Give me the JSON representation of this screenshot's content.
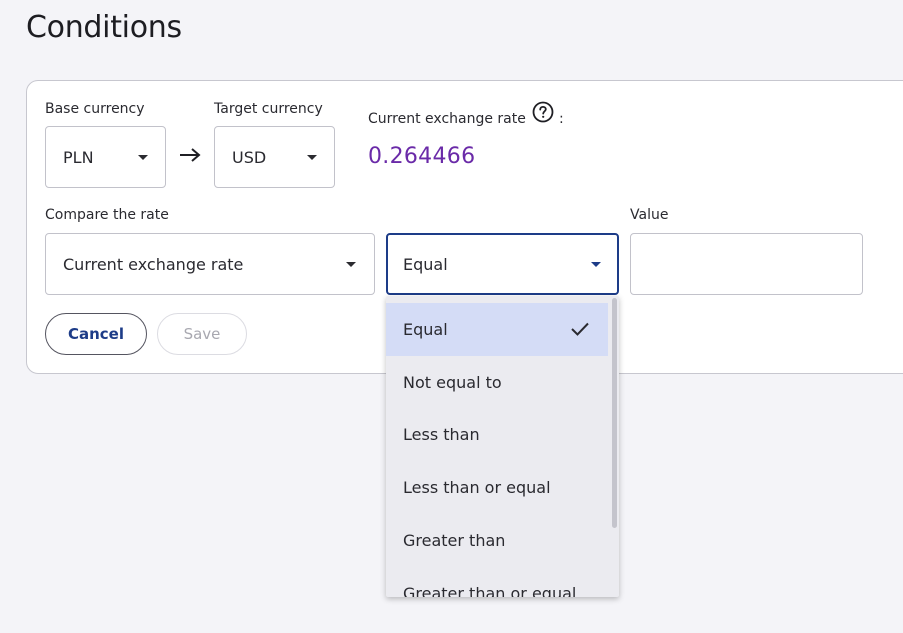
{
  "page": {
    "title": "Conditions"
  },
  "currency": {
    "base_label": "Base currency",
    "base_value": "PLN",
    "target_label": "Target currency",
    "target_value": "USD",
    "rate_label": "Current exchange rate",
    "rate_colon": ":",
    "rate_value": "0.264466"
  },
  "compare": {
    "label": "Compare the rate",
    "field_value": "Current exchange rate",
    "operator_value": "Equal",
    "value_label": "Value",
    "value_input": ""
  },
  "buttons": {
    "cancel": "Cancel",
    "save": "Save"
  },
  "dropdown": {
    "options": [
      {
        "label": "Equal",
        "selected": true
      },
      {
        "label": "Not equal to"
      },
      {
        "label": "Less than"
      },
      {
        "label": "Less than or equal"
      },
      {
        "label": "Greater than"
      },
      {
        "label": "Greater than or equal"
      }
    ]
  },
  "colors": {
    "accent": "#1d3c88",
    "rate": "#6a2aa8",
    "selected_bg": "#d4dcf6"
  },
  "icons": [
    "chevron-down-icon",
    "arrow-right-icon",
    "help-icon",
    "check-icon"
  ]
}
